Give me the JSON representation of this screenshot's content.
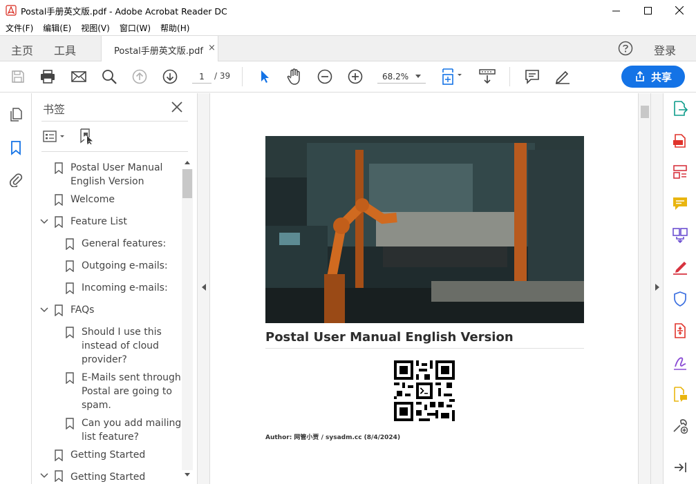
{
  "window": {
    "title": "Postal手册英文版.pdf - Adobe Acrobat Reader DC"
  },
  "menu": [
    "文件(F)",
    "编辑(E)",
    "视图(V)",
    "窗口(W)",
    "帮助(H)"
  ],
  "tabs": {
    "home": "主页",
    "tools": "工具",
    "document": "Postal手册英文版.pdf",
    "close_glyph": "×",
    "login": "登录"
  },
  "toolbar": {
    "current_page": "1",
    "total_pages": "/ 39",
    "zoom": "68.2%",
    "share_label": "共享"
  },
  "bookmarks": {
    "header": "书签",
    "items": [
      {
        "label_lines": [
          "Postal User Manual",
          "English Version"
        ]
      },
      {
        "label_lines": [
          "Welcome"
        ]
      },
      {
        "label_lines": [
          "Feature List"
        ],
        "expanded": true
      },
      {
        "label_lines": [
          "General features:"
        ]
      },
      {
        "label_lines": [
          "Outgoing e-mails:"
        ]
      },
      {
        "label_lines": [
          "Incoming e-mails:"
        ]
      },
      {
        "label_lines": [
          "FAQs"
        ],
        "expanded": true
      },
      {
        "label_lines": [
          "Should I use this",
          "instead of cloud",
          "provider?"
        ]
      },
      {
        "label_lines": [
          "E-Mails sent through",
          "Postal are going to",
          "spam."
        ]
      },
      {
        "label_lines": [
          "Can you add mailing",
          "list feature?"
        ]
      },
      {
        "label_lines": [
          "Getting Started"
        ]
      },
      {
        "label_lines": [
          "Getting Started"
        ],
        "expanded": true
      }
    ]
  },
  "document": {
    "title": "Postal User Manual English Version",
    "author_line": "Author: 网管小贾 / sysadm.cc (8/4/2024)"
  },
  "colors": {
    "accent": "#1473e6",
    "export": "#0d9c8a",
    "create": "#e0332b",
    "edit": "#d7333f",
    "comment": "#e9b50f",
    "combine": "#6c4fd1",
    "protect": "#3b6fe0",
    "sign": "#8a4bd4"
  },
  "icons": {
    "right_rail": [
      "export-pdf-icon",
      "create-pdf-icon",
      "edit-pdf-icon",
      "comment-icon",
      "combine-files-icon",
      "fill-sign-icon",
      "protect-icon",
      "compress-pdf-icon",
      "request-signature-icon",
      "send-for-comments-icon",
      "more-tools-icon",
      "collapse-rail-icon"
    ]
  }
}
